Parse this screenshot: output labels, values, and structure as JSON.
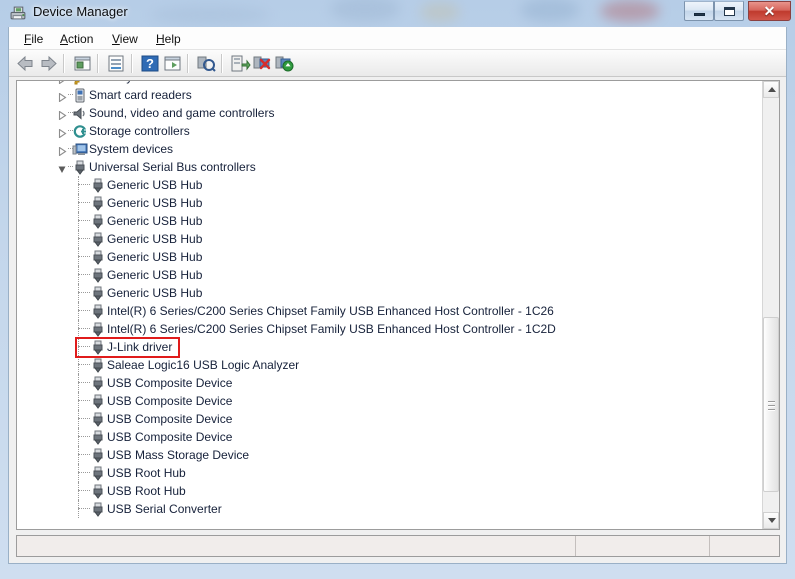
{
  "window": {
    "title": "Device Manager",
    "title_icon": "device-manager-icon",
    "buttons": {
      "minimize": "Minimize",
      "restore": "Restore",
      "close": "Close",
      "close_glyph": "✕"
    }
  },
  "menubar": {
    "items": [
      {
        "label": "File",
        "accel": "F"
      },
      {
        "label": "Action",
        "accel": "A"
      },
      {
        "label": "View",
        "accel": "V"
      },
      {
        "label": "Help",
        "accel": "H"
      }
    ]
  },
  "toolbar": {
    "items": [
      {
        "name": "back-icon",
        "tip": "Back"
      },
      {
        "name": "forward-icon",
        "tip": "Forward"
      },
      {
        "name": "show-hide-tree-icon",
        "tip": "Show/Hide Console Tree"
      },
      {
        "name": "properties-icon",
        "tip": "Properties"
      },
      {
        "name": "help-icon",
        "tip": "Help"
      },
      {
        "name": "show-pane-icon",
        "tip": "Show/Hide Action Pane"
      },
      {
        "name": "scan-hardware-icon",
        "tip": "Scan for hardware changes"
      },
      {
        "name": "update-driver-icon",
        "tip": "Update Driver Software"
      },
      {
        "name": "uninstall-device-icon",
        "tip": "Uninstall"
      },
      {
        "name": "enable-device-icon",
        "tip": "Enable"
      }
    ]
  },
  "tree": {
    "nodes": [
      {
        "level": 1,
        "label": "Security Devices",
        "icon": "security-device-icon",
        "expanded": false,
        "clipped": true
      },
      {
        "level": 1,
        "label": "Smart card readers",
        "icon": "smart-card-reader-icon",
        "expanded": false
      },
      {
        "level": 1,
        "label": "Sound, video and game controllers",
        "icon": "speaker-icon",
        "expanded": false
      },
      {
        "level": 1,
        "label": "Storage controllers",
        "icon": "storage-controller-icon",
        "expanded": false
      },
      {
        "level": 1,
        "label": "System devices",
        "icon": "system-device-icon",
        "expanded": false
      },
      {
        "level": 1,
        "label": "Universal Serial Bus controllers",
        "icon": "usb-icon",
        "expanded": true
      },
      {
        "level": 2,
        "label": "Generic USB Hub",
        "icon": "usb-icon"
      },
      {
        "level": 2,
        "label": "Generic USB Hub",
        "icon": "usb-icon"
      },
      {
        "level": 2,
        "label": "Generic USB Hub",
        "icon": "usb-icon"
      },
      {
        "level": 2,
        "label": "Generic USB Hub",
        "icon": "usb-icon"
      },
      {
        "level": 2,
        "label": "Generic USB Hub",
        "icon": "usb-icon"
      },
      {
        "level": 2,
        "label": "Generic USB Hub",
        "icon": "usb-icon"
      },
      {
        "level": 2,
        "label": "Generic USB Hub",
        "icon": "usb-icon"
      },
      {
        "level": 2,
        "label": "Intel(R) 6 Series/C200 Series Chipset Family USB Enhanced Host Controller - 1C26",
        "icon": "usb-icon"
      },
      {
        "level": 2,
        "label": "Intel(R) 6 Series/C200 Series Chipset Family USB Enhanced Host Controller - 1C2D",
        "icon": "usb-icon"
      },
      {
        "level": 2,
        "label": "J-Link driver",
        "icon": "usb-icon",
        "highlighted": true
      },
      {
        "level": 2,
        "label": "Saleae Logic16 USB Logic Analyzer",
        "icon": "usb-icon"
      },
      {
        "level": 2,
        "label": "USB Composite Device",
        "icon": "usb-icon"
      },
      {
        "level": 2,
        "label": "USB Composite Device",
        "icon": "usb-icon"
      },
      {
        "level": 2,
        "label": "USB Composite Device",
        "icon": "usb-icon"
      },
      {
        "level": 2,
        "label": "USB Composite Device",
        "icon": "usb-icon"
      },
      {
        "level": 2,
        "label": "USB Mass Storage Device",
        "icon": "usb-icon"
      },
      {
        "level": 2,
        "label": "USB Root Hub",
        "icon": "usb-icon"
      },
      {
        "level": 2,
        "label": "USB Root Hub",
        "icon": "usb-icon"
      },
      {
        "level": 2,
        "label": "USB Serial Converter",
        "icon": "usb-icon"
      }
    ]
  },
  "annotation": {
    "highlight_color": "#e01b1b",
    "target_label": "J-Link driver"
  },
  "scrollbar": {
    "up_arrow": "scroll-up-icon",
    "down_arrow": "scroll-down-icon",
    "thumb": "scroll-thumb"
  },
  "statusbar": {
    "text": "",
    "panel2": "",
    "panel3": ""
  },
  "colors": {
    "tree_text": "#16213a",
    "window_chrome": "#b6cde7",
    "close_button": "#bf3a2d",
    "list_background": "#ffffff"
  }
}
